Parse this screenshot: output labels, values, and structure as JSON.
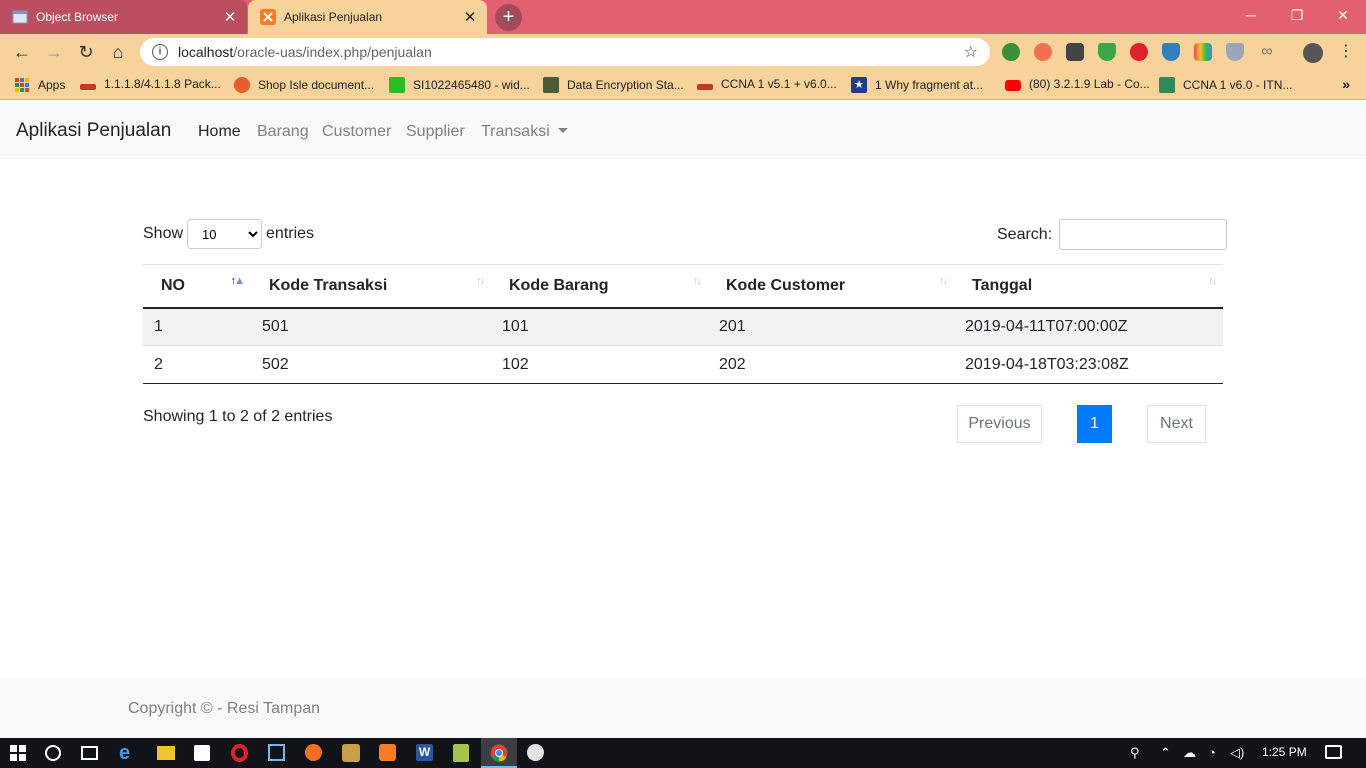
{
  "browser": {
    "tabs": [
      {
        "title": "Object Browser",
        "active": false
      },
      {
        "title": "Aplikasi Penjualan",
        "active": true
      }
    ],
    "url_host": "localhost",
    "url_path": "/oracle-uas/index.php/penjualan",
    "bookmarks": [
      {
        "label": "Apps"
      },
      {
        "label": "1.1.1.8/4.1.1.8 Pack..."
      },
      {
        "label": "Shop Isle document..."
      },
      {
        "label": "SI1022465480 - wid..."
      },
      {
        "label": "Data Encryption Sta..."
      },
      {
        "label": "CCNA 1 v5.1 + v6.0..."
      },
      {
        "label": "1 Why fragment at..."
      },
      {
        "label": "(80) 3.2.1.9 Lab - Co..."
      },
      {
        "label": "CCNA 1 v6.0 - ITN..."
      }
    ]
  },
  "navbar": {
    "brand": "Aplikasi Penjualan",
    "links": [
      "Home",
      "Barang",
      "Customer",
      "Supplier",
      "Transaksi"
    ]
  },
  "table_controls": {
    "show_label": "Show",
    "entries_value": "10",
    "entries_label": "entries",
    "search_label": "Search:",
    "search_value": ""
  },
  "table": {
    "columns": [
      "NO",
      "Kode Transaksi",
      "Kode Barang",
      "Kode Customer",
      "Tanggal"
    ],
    "rows": [
      [
        "1",
        "501",
        "101",
        "201",
        "2019-04-11T07:00:00Z"
      ],
      [
        "2",
        "502",
        "102",
        "202",
        "2019-04-18T03:23:08Z"
      ]
    ]
  },
  "pagination": {
    "info": "Showing 1 to 2 of 2 entries",
    "previous": "Previous",
    "current": "1",
    "next": "Next"
  },
  "footer": {
    "text": "Copyright © - Resi Tampan"
  },
  "taskbar": {
    "time": "1:25 PM"
  },
  "colors": {
    "tabstrip": "#e2606f",
    "toolbar": "#f7d29a",
    "primary": "#007bff"
  }
}
